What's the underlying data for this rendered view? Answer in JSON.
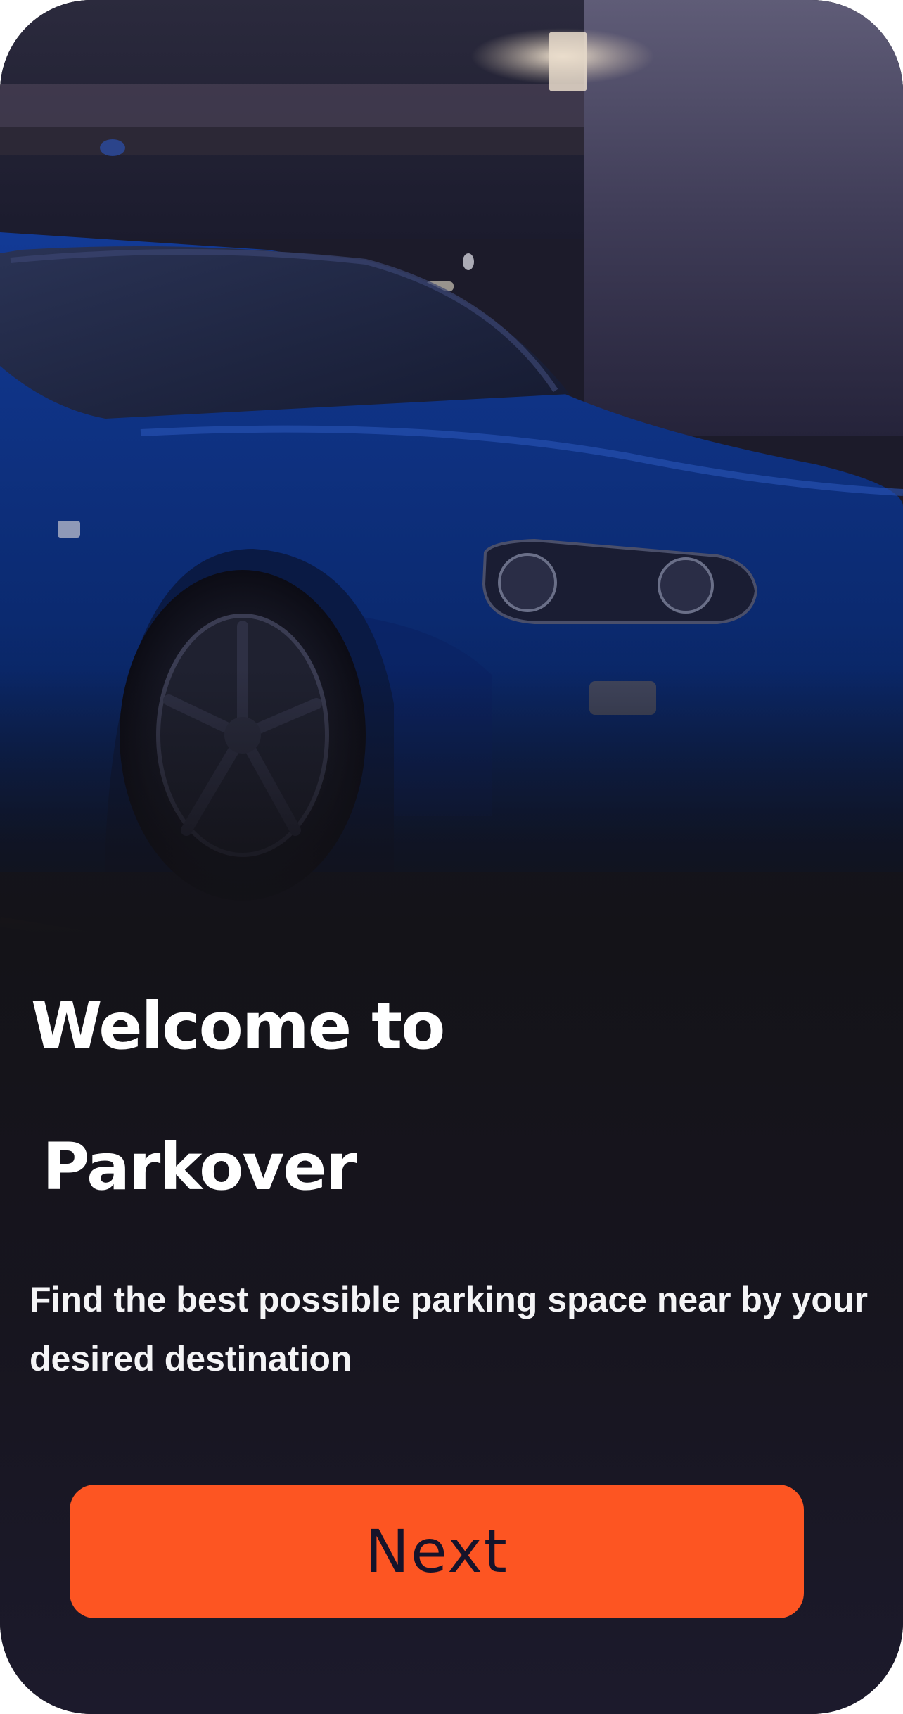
{
  "onboarding": {
    "title_line1": "Welcome to",
    "title_line2": "Parkover",
    "description": "Find the best possible parking space near by your desired destination",
    "next_label": "Next"
  },
  "colors": {
    "background": "#16151c",
    "button_bg": "#fd5522",
    "button_text": "#16132a",
    "title_text": "#ffffff",
    "car_body": "#0b2a78"
  },
  "icons": {
    "hero": "car-photo"
  }
}
